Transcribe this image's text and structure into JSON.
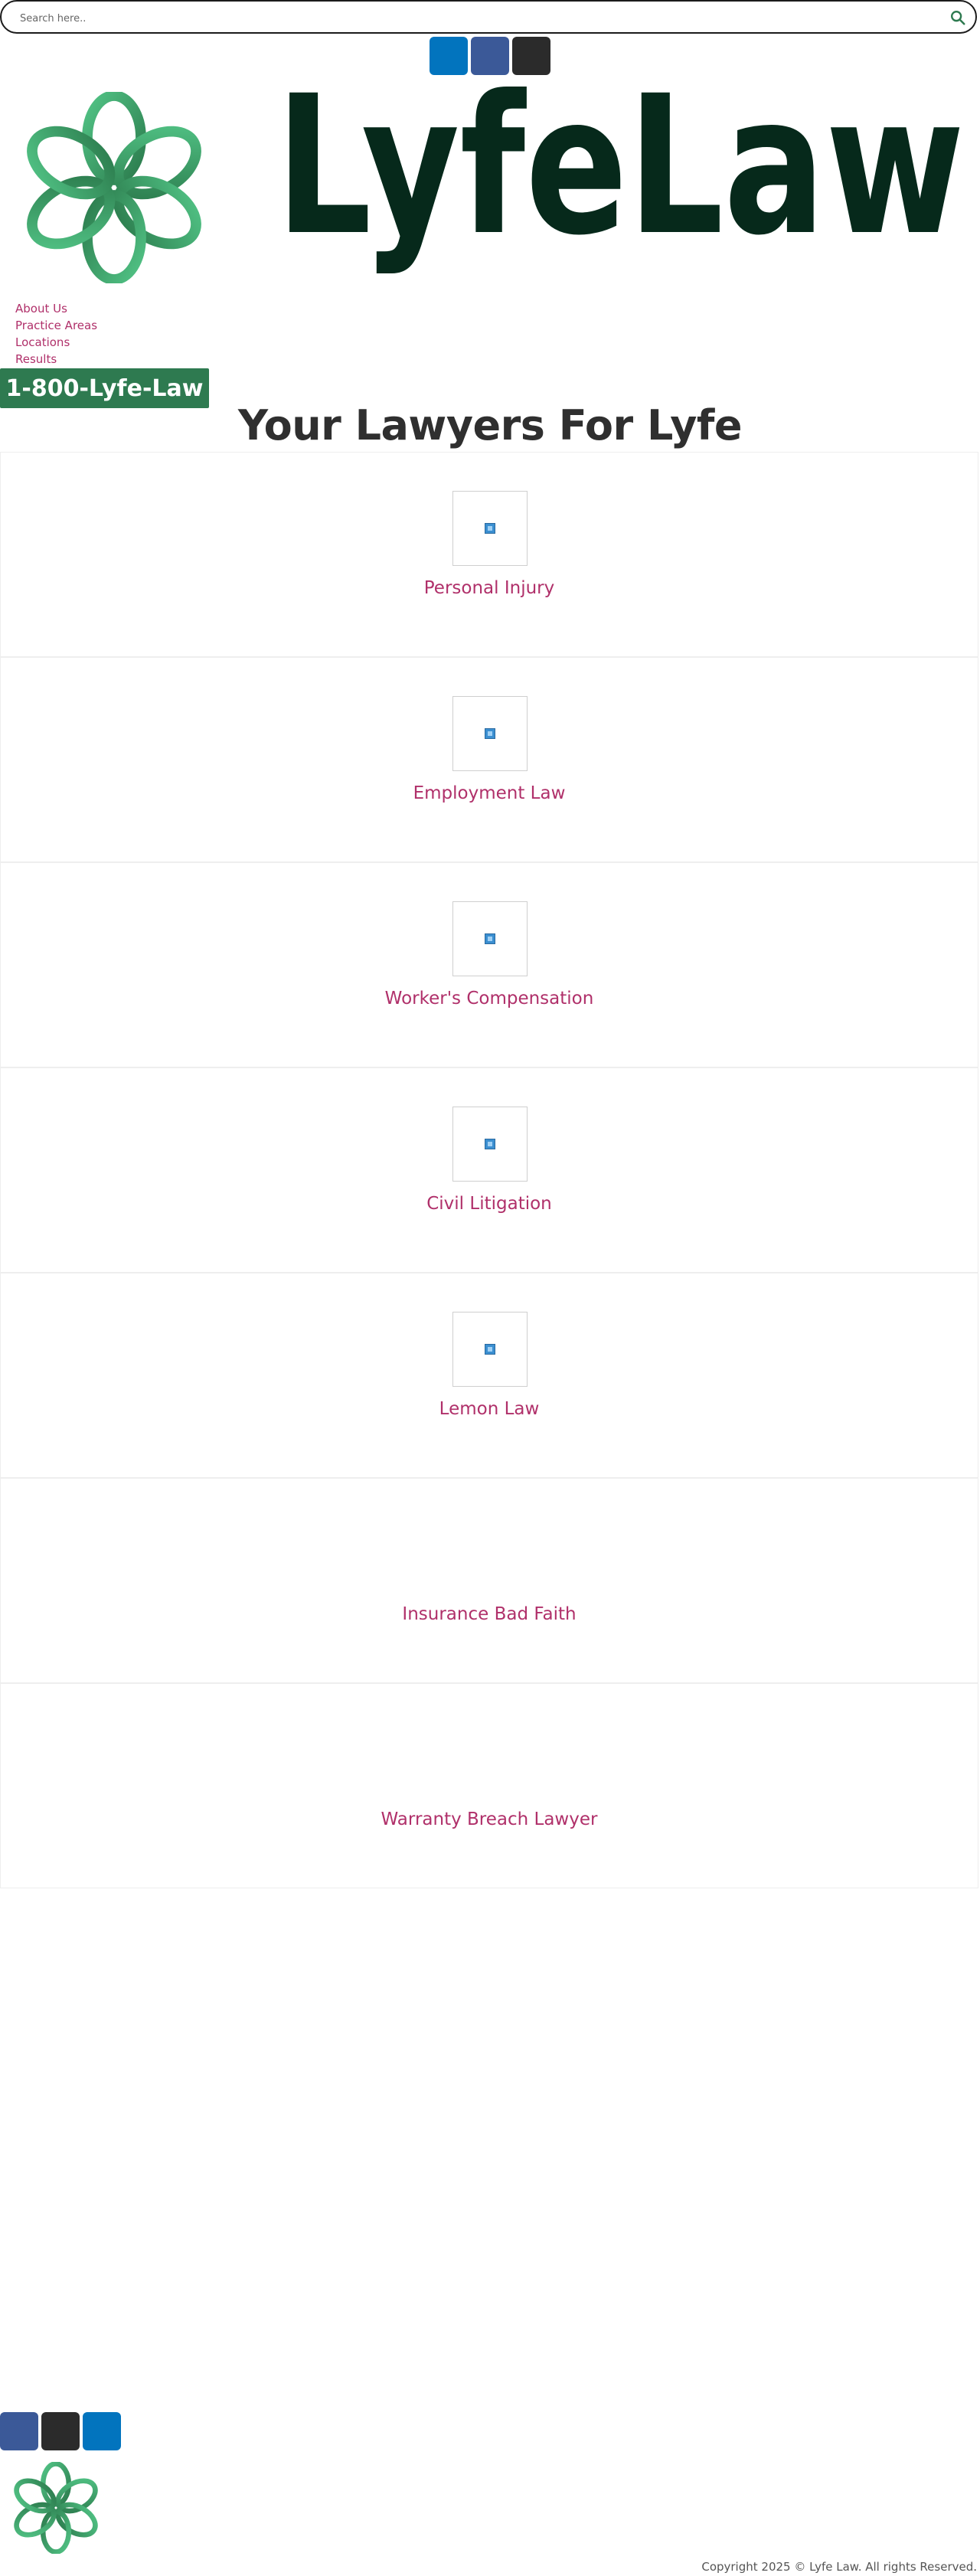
{
  "search": {
    "placeholder": "Search here..",
    "icon": "search-icon"
  },
  "social_top": [
    {
      "icon": "linkedin-icon",
      "color": "#0274be"
    },
    {
      "icon": "facebook-icon",
      "color": "#3b5998"
    },
    {
      "icon": "instagram-icon",
      "color": "#2b2b2b"
    }
  ],
  "brand": {
    "wordmark": "LyfeLaw",
    "logo_color_dark": "#06291b",
    "logo_color_mark": "#3aa36a"
  },
  "nav": {
    "items": [
      "About Us",
      "Practice Areas",
      "Locations",
      "Results"
    ]
  },
  "cta": {
    "phone": "1-800-Lyfe-Law"
  },
  "hero": {
    "title": "Your Lawyers For Lyfe"
  },
  "practice_areas": [
    {
      "label": "Personal Injury",
      "has_image": true
    },
    {
      "label": "Employment Law",
      "has_image": true
    },
    {
      "label": "Worker's Compensation",
      "has_image": true
    },
    {
      "label": "Civil Litigation",
      "has_image": true
    },
    {
      "label": "Lemon Law",
      "has_image": true
    },
    {
      "label": "Insurance Bad Faith",
      "has_image": false
    },
    {
      "label": "Warranty Breach Lawyer",
      "has_image": false
    }
  ],
  "social_bottom": [
    {
      "icon": "facebook-icon",
      "color": "#3b5998"
    },
    {
      "icon": "instagram-icon",
      "color": "#2b2b2b"
    },
    {
      "icon": "linkedin-icon",
      "color": "#0274be"
    }
  ],
  "footer": {
    "copyright": "Copyright 2025 © Lyfe Law. All rights Reserved."
  },
  "colors": {
    "accent": "#b0306a",
    "cta_bg": "#2e7a50",
    "heading": "#2f2f2f"
  }
}
